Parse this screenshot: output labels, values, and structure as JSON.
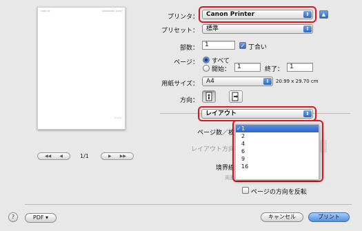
{
  "preview": {
    "header_left": "xxxx xx",
    "header_right": "xxxxxxxxx x xxx",
    "footer": "x-x-xx",
    "page_counter": "1/1"
  },
  "printer": {
    "label": "プリンタ：",
    "value": "Canon Printer"
  },
  "preset": {
    "label": "プリセット：",
    "value": "標準"
  },
  "copies": {
    "label": "部数：",
    "value": "1",
    "collate_label": "丁合い",
    "collate_checked": true
  },
  "pages": {
    "label": "ページ：",
    "all_label": "すべて",
    "from_label": "開始：",
    "from_value": "1",
    "to_label": "終了：",
    "to_value": "1"
  },
  "paper": {
    "label": "用紙サイズ：",
    "value": "A4",
    "dimensions": "20.99 x 29.70 cm"
  },
  "orientation": {
    "label": "方向："
  },
  "section_popup": {
    "value": "レイアウト"
  },
  "layout": {
    "pages_per_sheet_label": "ページ数／枚",
    "direction_label": "レイアウト方向",
    "border_label": "境界線",
    "duplex_label": "両面",
    "duplex_value": "切",
    "reverse_label": "ページの方向を反転",
    "reverse_checked": false
  },
  "pages_per_sheet_menu": {
    "items": [
      "1",
      "2",
      "4",
      "6",
      "9",
      "16"
    ],
    "selected": "1",
    "checkmark": "✓"
  },
  "footer": {
    "pdf_label": "PDF ▾",
    "cancel_label": "キャンセル",
    "print_label": "プリント",
    "help_label": "?"
  },
  "colors": {
    "accent": "#2b68c7",
    "highlight_ring": "#e0141c"
  }
}
